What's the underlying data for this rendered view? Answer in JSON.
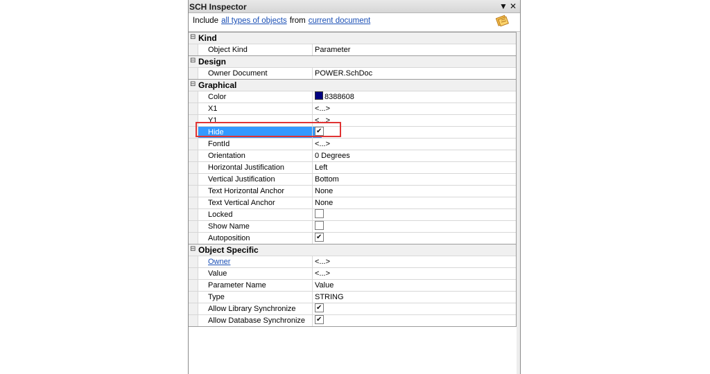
{
  "window": {
    "title": "SCH Inspector",
    "dropdown_icon": "dropdown-arrow-icon",
    "close_icon": "close-icon"
  },
  "include_bar": {
    "prefix": "Include",
    "object_filter_link": "all types of objects",
    "from_text": "from",
    "scope_link": "current document",
    "filter_icon": "filter-icon"
  },
  "colors": {
    "selection": "#3399ff",
    "highlight_box": "#e03333",
    "link": "#1a4fb5",
    "color_swatch": "#000080"
  },
  "categories": [
    {
      "name": "Kind",
      "expanded_symbol": "⊟",
      "rows": [
        {
          "key": "Object Kind",
          "value": "Parameter"
        }
      ]
    },
    {
      "name": "Design",
      "expanded_symbol": "⊟",
      "rows": [
        {
          "key": "Owner Document",
          "value": "POWER.SchDoc"
        }
      ]
    },
    {
      "name": "Graphical",
      "expanded_symbol": "⊟",
      "rows": [
        {
          "key": "Color",
          "value": "8388608",
          "swatch": true
        },
        {
          "key": "X1",
          "value": "<...>"
        },
        {
          "key": "Y1",
          "value": "<...>"
        },
        {
          "key": "Hide",
          "checkbox": true,
          "checked": true,
          "selected": true
        },
        {
          "key": "FontId",
          "value": "<...>"
        },
        {
          "key": "Orientation",
          "value": "0 Degrees"
        },
        {
          "key": "Horizontal Justification",
          "value": "Left"
        },
        {
          "key": "Vertical Justification",
          "value": "Bottom"
        },
        {
          "key": "Text Horizontal Anchor",
          "value": "None"
        },
        {
          "key": "Text Vertical Anchor",
          "value": "None"
        },
        {
          "key": "Locked",
          "checkbox": true,
          "checked": false
        },
        {
          "key": "Show Name",
          "checkbox": true,
          "checked": false
        },
        {
          "key": "Autoposition",
          "checkbox": true,
          "checked": true
        }
      ]
    },
    {
      "name": "Object Specific",
      "expanded_symbol": "⊟",
      "rows": [
        {
          "key": "Owner",
          "value": "<...>",
          "link": true
        },
        {
          "key": "Value",
          "value": "<...>"
        },
        {
          "key": "Parameter Name",
          "value": "Value"
        },
        {
          "key": "Type",
          "value": "STRING"
        },
        {
          "key": "Allow Library Synchronize",
          "checkbox": true,
          "checked": true
        },
        {
          "key": "Allow Database Synchronize",
          "checkbox": true,
          "checked": true
        }
      ]
    }
  ]
}
